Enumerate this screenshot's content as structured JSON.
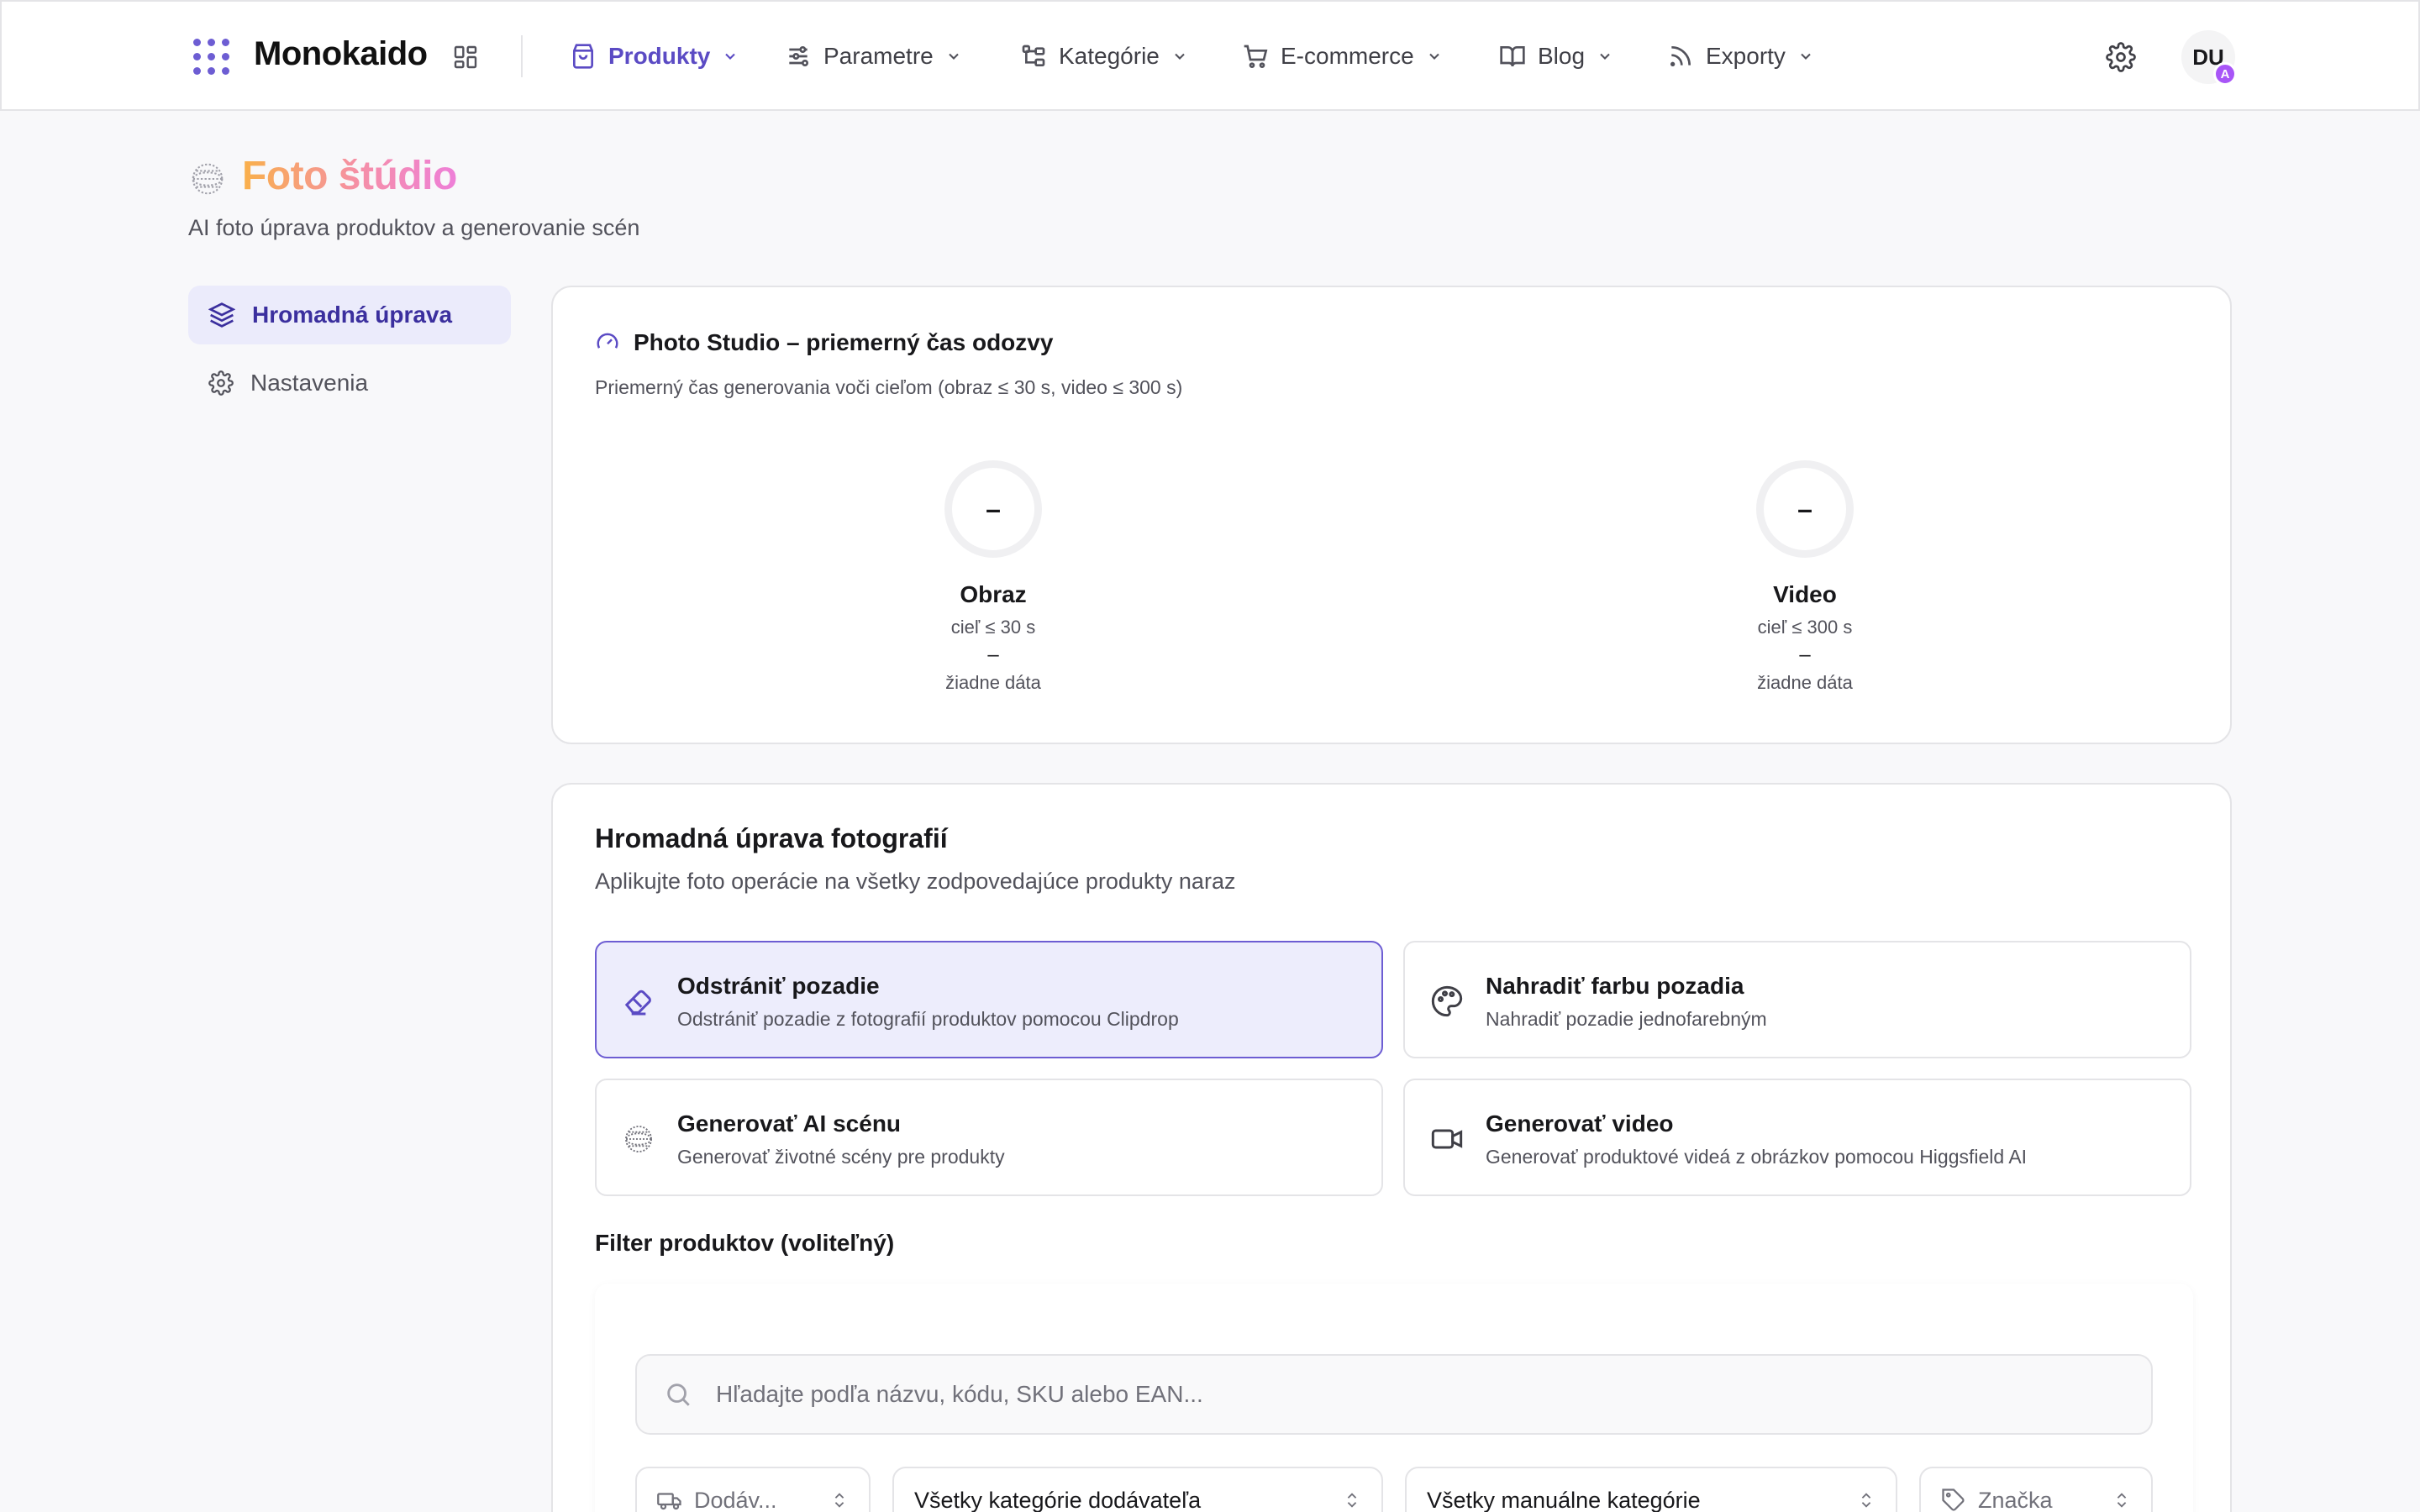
{
  "app": {
    "name": "Monokaido",
    "user_initials": "DU",
    "user_badge": "A"
  },
  "nav": {
    "items": [
      {
        "label": "Produkty",
        "icon": "shopping-bag-icon",
        "active": true
      },
      {
        "label": "Parametre",
        "icon": "sliders-icon"
      },
      {
        "label": "Kategórie",
        "icon": "category-tree-icon"
      },
      {
        "label": "E-commerce",
        "icon": "cart-icon"
      },
      {
        "label": "Blog",
        "icon": "book-open-icon"
      },
      {
        "label": "Exporty",
        "icon": "rss-icon"
      }
    ]
  },
  "page": {
    "title": "Foto štúdio",
    "subtitle": "AI foto úprava produktov a generovanie scén"
  },
  "sidebar": {
    "items": [
      {
        "label": "Hromadná úprava",
        "icon": "layers-icon",
        "active": true
      },
      {
        "label": "Nastavenia",
        "icon": "gear-icon"
      }
    ]
  },
  "metrics_card": {
    "title": "Photo Studio – priemerný čas odozvy",
    "subtitle": "Priemerný čas generovania voči cieľom (obraz ≤ 30 s, video ≤ 300 s)",
    "metrics": [
      {
        "ring_value": "–",
        "label": "Obraz",
        "target": "cieľ ≤ 30 s",
        "value": "–",
        "status": "žiadne dáta"
      },
      {
        "ring_value": "–",
        "label": "Video",
        "target": "cieľ ≤ 300 s",
        "value": "–",
        "status": "žiadne dáta"
      }
    ]
  },
  "bulk_card": {
    "title": "Hromadná úprava fotografií",
    "subtitle": "Aplikujte foto operácie na všetky zodpovedajúce produkty naraz",
    "operations": [
      {
        "title": "Odstrániť pozadie",
        "description": "Odstrániť pozadie z fotografií produktov pomocou Clipdrop",
        "icon": "eraser-icon",
        "selected": true
      },
      {
        "title": "Nahradiť farbu pozadia",
        "description": "Nahradiť pozadie jednofarebným",
        "icon": "palette-icon"
      },
      {
        "title": "Generovať AI scénu",
        "description": "Generovať životné scény pre produkty",
        "icon": "sparkle-sphere-icon"
      },
      {
        "title": "Generovať video",
        "description": "Generovať produktové videá z obrázkov pomocou Higgsfield AI",
        "icon": "video-icon"
      }
    ],
    "filter_label": "Filter produktov (voliteľný)",
    "search_placeholder": "Hľadajte podľa názvu, kódu, SKU alebo EAN...",
    "selects": [
      {
        "label": "Dodáv...",
        "icon": "truck-icon"
      },
      {
        "label": "Všetky kategórie dodávateľa"
      },
      {
        "label": "Všetky manuálne kategórie"
      },
      {
        "label": "Značka",
        "icon": "tag-icon"
      }
    ]
  },
  "colors": {
    "accent": "#5b4bc4",
    "accent_bg": "#ebebfb",
    "title_gradient_start": "#f9b04a",
    "title_gradient_end": "#ee7fd8"
  }
}
